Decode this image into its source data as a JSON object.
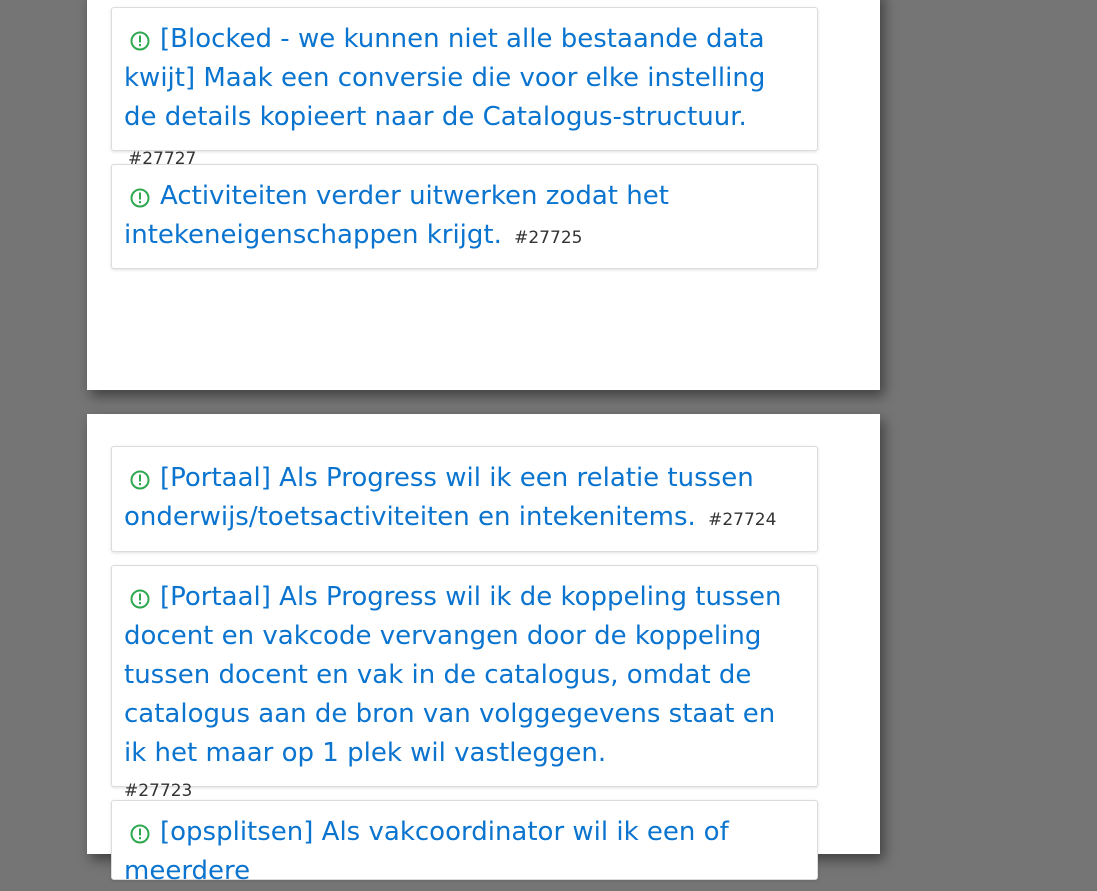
{
  "colors": {
    "background": "#757575",
    "panel": "#ffffff",
    "link": "#0a74cf",
    "icon": "#2fa84f",
    "id_text": "#333333"
  },
  "panels": [
    {
      "cards": [
        {
          "icon": "exclamation-circle-icon",
          "title": "[Blocked - we kunnen niet alle bestaande data kwijt] Maak een conversie die voor elke instelling de details kopieert naar de Catalogus-structuur.",
          "id": "#27727"
        },
        {
          "icon": "exclamation-circle-icon",
          "title": "Activiteiten verder uitwerken zodat het intekeneigenschappen krijgt.",
          "id": "#27725"
        }
      ]
    },
    {
      "cards": [
        {
          "icon": "exclamation-circle-icon",
          "title": "[Portaal] Als Progress wil ik een relatie tussen onderwijs/toetsactiviteiten en intekenitems.",
          "id": "#27724"
        },
        {
          "icon": "exclamation-circle-icon",
          "title": "[Portaal] Als Progress wil ik de koppeling tussen docent en vakcode vervangen door de koppeling tussen docent en vak in de catalogus, omdat de catalogus aan de bron van volggegevens staat en ik het maar op 1 plek wil vastleggen.",
          "id": "#27723"
        },
        {
          "icon": "exclamation-circle-icon",
          "title": "[opsplitsen] Als vakcoordinator wil ik een of meerdere"
        }
      ]
    }
  ]
}
